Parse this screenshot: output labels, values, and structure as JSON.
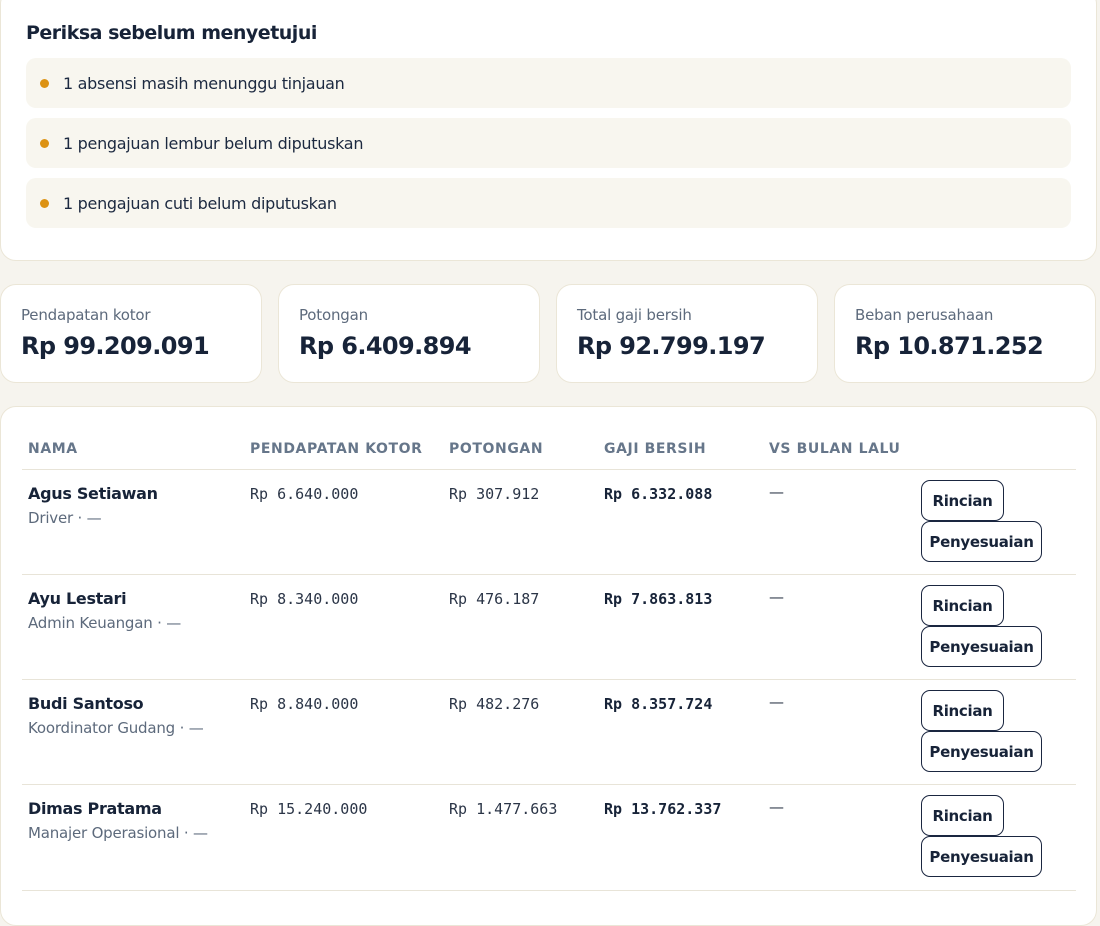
{
  "review": {
    "title": "Periksa sebelum menyetujui",
    "items": [
      "1 absensi masih menunggu tinjauan",
      "1 pengajuan lembur belum diputuskan",
      "1 pengajuan cuti belum diputuskan"
    ]
  },
  "stats": [
    {
      "label": "Pendapatan kotor",
      "value": "Rp 99.209.091"
    },
    {
      "label": "Potongan",
      "value": "Rp 6.409.894"
    },
    {
      "label": "Total gaji bersih",
      "value": "Rp 92.799.197"
    },
    {
      "label": "Beban perusahaan",
      "value": "Rp 10.871.252"
    }
  ],
  "table": {
    "headers": [
      "NAMA",
      "PENDAPATAN KOTOR",
      "POTONGAN",
      "GAJI BERSIH",
      "VS BULAN LALU"
    ],
    "rows": [
      {
        "name": "Agus Setiawan",
        "role": "Driver · —",
        "gross": "Rp 6.640.000",
        "deduction": "Rp 307.912",
        "net": "Rp 6.332.088",
        "vs": "—"
      },
      {
        "name": "Ayu Lestari",
        "role": "Admin Keuangan · —",
        "gross": "Rp 8.340.000",
        "deduction": "Rp 476.187",
        "net": "Rp 7.863.813",
        "vs": "—"
      },
      {
        "name": "Budi Santoso",
        "role": "Koordinator Gudang · —",
        "gross": "Rp 8.840.000",
        "deduction": "Rp 482.276",
        "net": "Rp 8.357.724",
        "vs": "—"
      },
      {
        "name": "Dimas Pratama",
        "role": "Manajer Operasional · —",
        "gross": "Rp 15.240.000",
        "deduction": "Rp 1.477.663",
        "net": "Rp 13.762.337",
        "vs": "—"
      }
    ],
    "actions": {
      "detail": "Rincian",
      "adjust": "Penyesuaian"
    }
  },
  "colors": {
    "accent_dot": "#dc9214",
    "text": "#172338",
    "muted": "#5d6a7c"
  }
}
